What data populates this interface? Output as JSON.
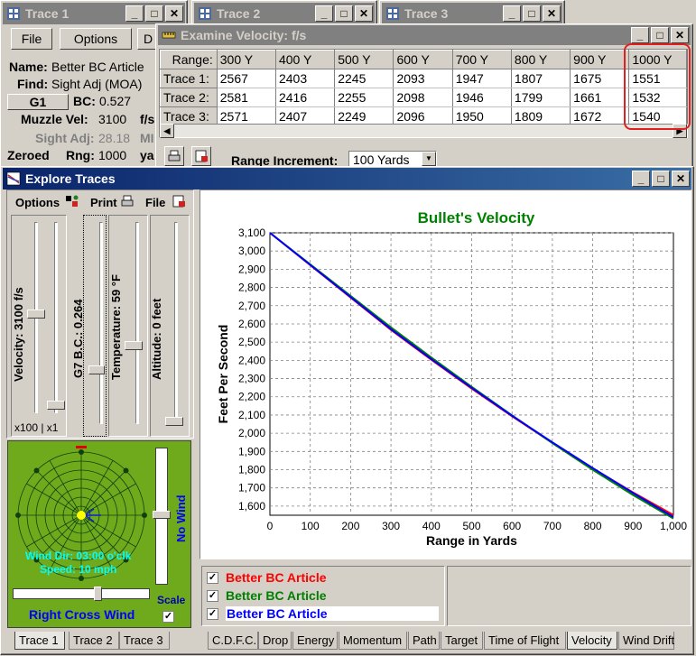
{
  "windows": {
    "trace1": {
      "title": "Trace 1"
    },
    "trace2": {
      "title": "Trace 2"
    },
    "trace3": {
      "title": "Trace 3"
    }
  },
  "trace1_panel": {
    "file_label": "File",
    "options_label": "Options",
    "third_label": "D",
    "name_label": "Name:",
    "name_value": "Better BC Article",
    "find_label": "Find:",
    "find_value": "Sight Adj (MOA)",
    "g1_label": "G1",
    "bc_label": "BC:",
    "bc_value": "0.527",
    "muzzle_label": "Muzzle Vel:",
    "muzzle_value": "3100",
    "muzzle_unit": "f/s",
    "sight_label": "Sight Adj:",
    "sight_value": "28.18",
    "sight_unit": "MI",
    "zeroed_label": "Zeroed",
    "rng_label": "Rng:",
    "rng_value": "1000",
    "rng_unit": "ya"
  },
  "examine": {
    "title": "Examine Velocity:  f/s",
    "headers": [
      "Range:",
      "300 Y",
      "400 Y",
      "500 Y",
      "600 Y",
      "700 Y",
      "800 Y",
      "900 Y",
      "1000 Y"
    ],
    "rows": [
      [
        "Trace 1:",
        "2567",
        "2403",
        "2245",
        "2093",
        "1947",
        "1807",
        "1675",
        "1551"
      ],
      [
        "Trace 2:",
        "2581",
        "2416",
        "2255",
        "2098",
        "1946",
        "1799",
        "1661",
        "1532"
      ],
      [
        "Trace 3:",
        "2571",
        "2407",
        "2249",
        "2096",
        "1950",
        "1809",
        "1672",
        "1540"
      ]
    ],
    "range_increment_label": "Range Increment:",
    "range_increment_value": "100 Yards",
    "highlight_color": "#e02020"
  },
  "explore": {
    "title": "Explore Traces",
    "options_label": "Options",
    "print_label": "Print",
    "file_label": "File",
    "velocity_label": "Velocity:  3100 f/s",
    "bc_label": "G7 B.C.:  0.264",
    "temp_label": "Temperature:  59 °F",
    "alt_label": "Altitude:  0 feet",
    "scale_label": "x100 | x1",
    "wind_dir": "Wind Dir: 03:00 o'clk",
    "wind_speed": "Speed: 10 mph",
    "no_wind": "No Wind",
    "cross_wind": "Right Cross Wind",
    "scale_check_label": "Scale",
    "left_tabs": [
      "Trace 1",
      "Trace 2",
      "Trace 3"
    ],
    "bottom_tabs": [
      "C.D.F.C.",
      "Drop",
      "Energy",
      "Momentum",
      "Path",
      "Target",
      "Time of Flight",
      "Velocity",
      "Wind Drift"
    ],
    "selected_tab": "Velocity"
  },
  "legend": [
    {
      "label": "Better BC Article",
      "color": "#ff0000",
      "checked": true
    },
    {
      "label": "Better BC Article",
      "color": "#008000",
      "checked": true
    },
    {
      "label": "Better BC Article",
      "color": "#0000ff",
      "checked": true
    }
  ],
  "chart_data": {
    "type": "line",
    "title": "Bullet's Velocity",
    "xlabel": "Range in Yards",
    "ylabel": "Feet Per Second",
    "xlim": [
      0,
      1000
    ],
    "ylim": [
      1550,
      3100
    ],
    "x_ticks": [
      "0",
      "100",
      "200",
      "300",
      "400",
      "500",
      "600",
      "700",
      "800",
      "900",
      "1,000"
    ],
    "y_ticks": [
      "1,600",
      "1,700",
      "1,800",
      "1,900",
      "2,000",
      "2,100",
      "2,200",
      "2,300",
      "2,400",
      "2,500",
      "2,600",
      "2,700",
      "2,800",
      "2,900",
      "3,000",
      "3,100"
    ],
    "grid": true,
    "x": [
      0,
      300,
      400,
      500,
      600,
      700,
      800,
      900,
      1000
    ],
    "series": [
      {
        "color": "#ff0000",
        "values": [
          3100,
          2567,
          2403,
          2245,
          2093,
          1947,
          1807,
          1675,
          1551
        ]
      },
      {
        "color": "#008000",
        "values": [
          3100,
          2581,
          2416,
          2255,
          2098,
          1946,
          1799,
          1661,
          1532
        ]
      },
      {
        "color": "#0000ff",
        "values": [
          3100,
          2571,
          2407,
          2249,
          2096,
          1950,
          1809,
          1672,
          1540
        ]
      }
    ]
  }
}
